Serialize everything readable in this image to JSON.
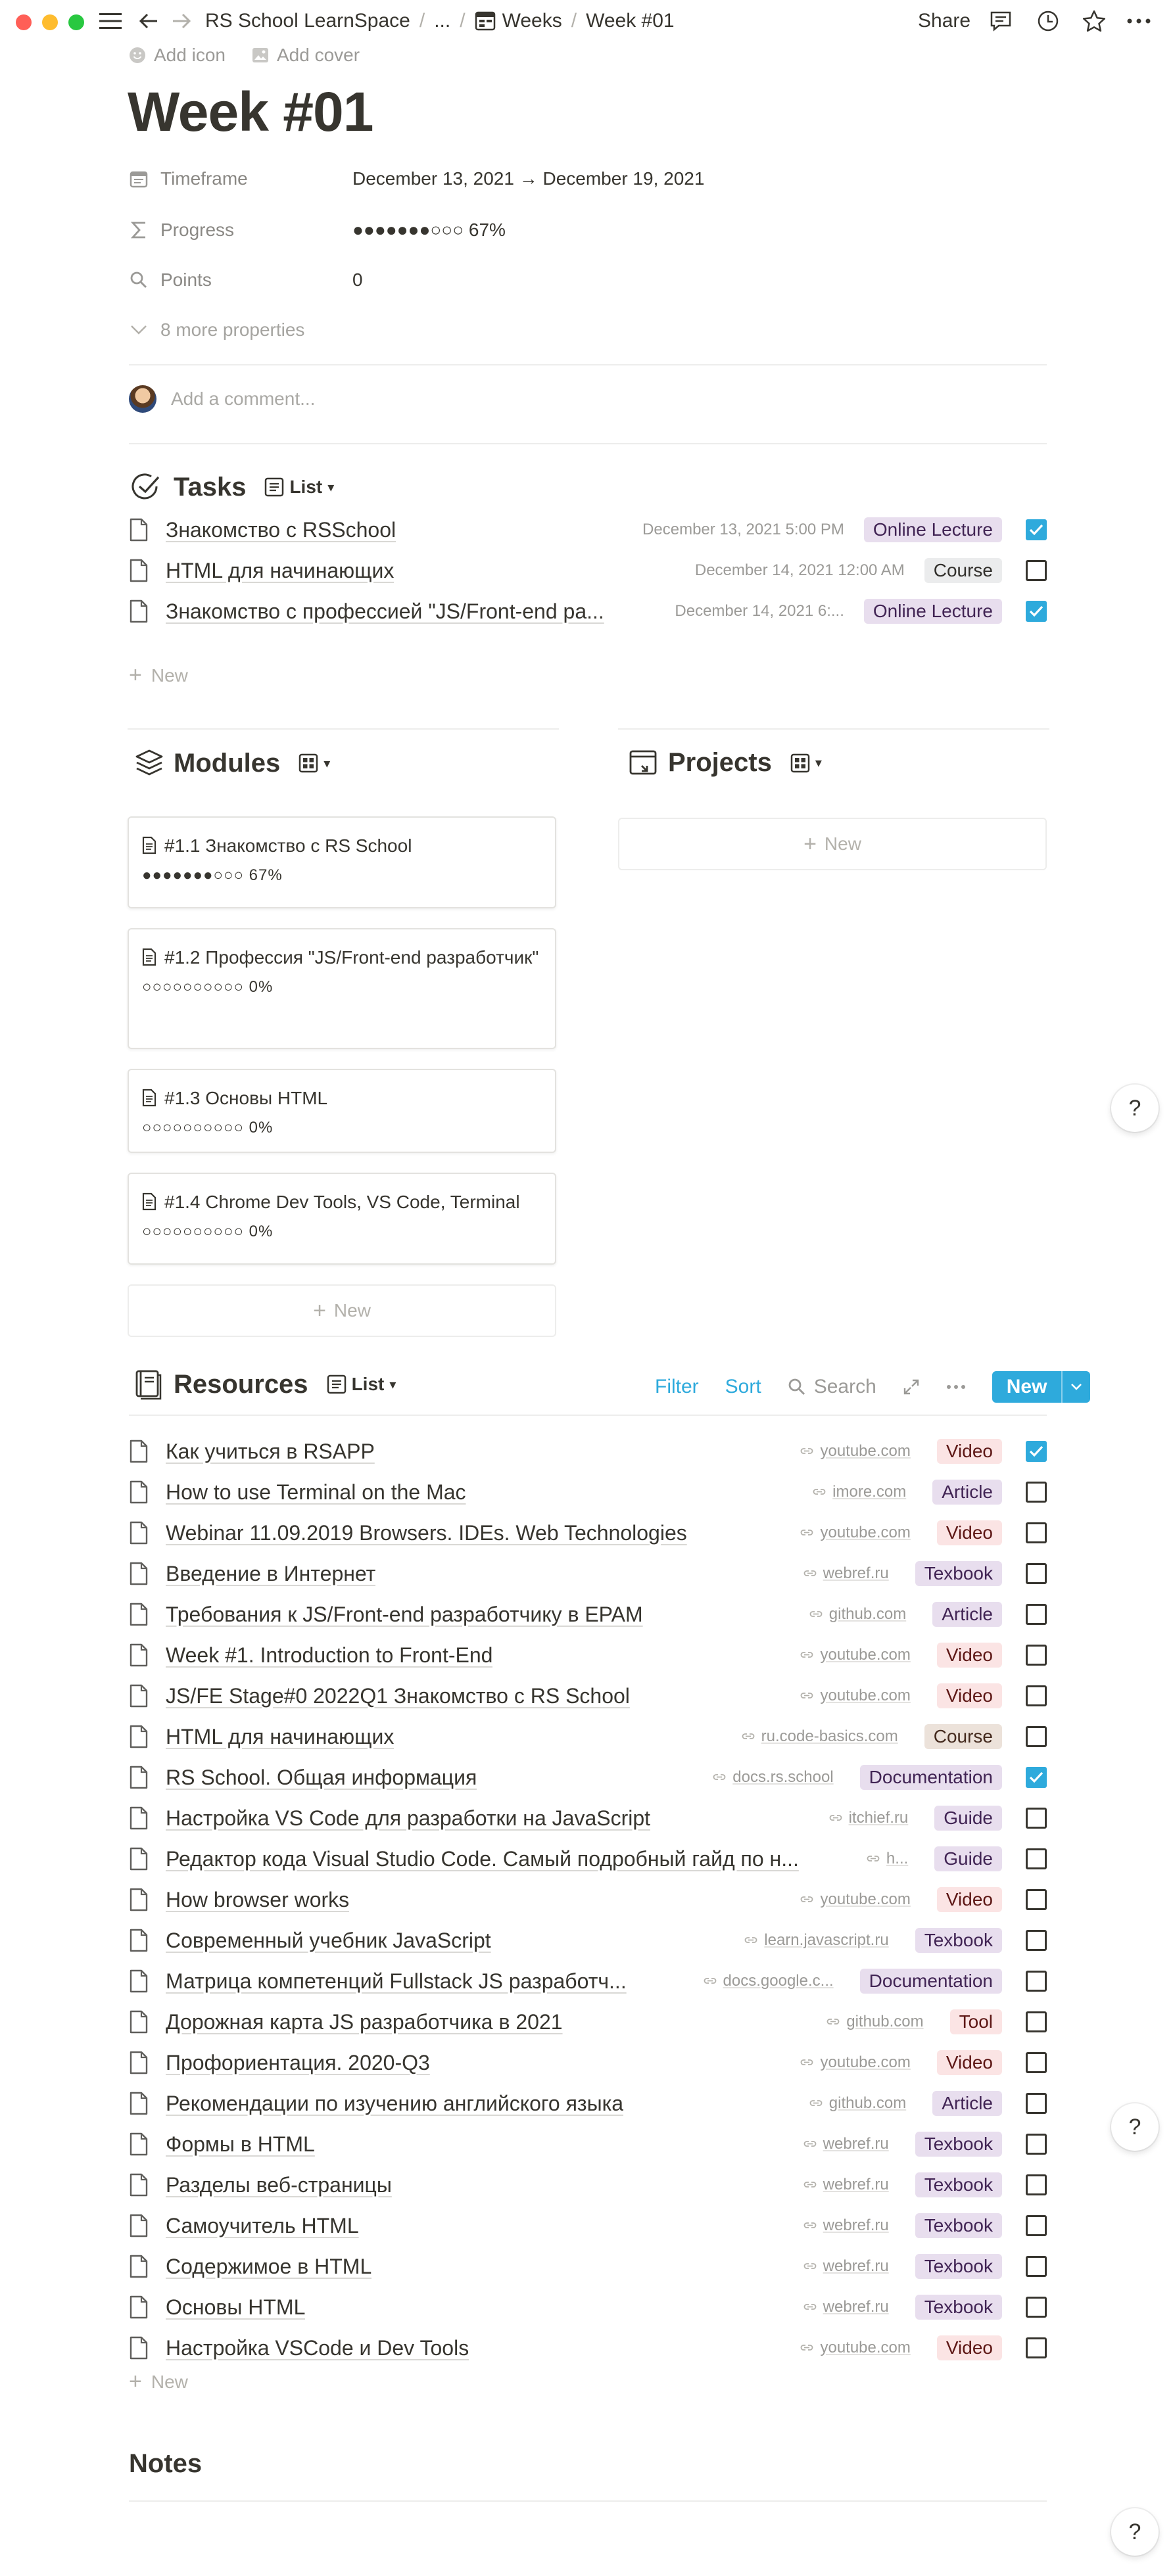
{
  "breadcrumb": [
    "RS School LearnSpace",
    "...",
    "Weeks",
    "Week #01"
  ],
  "topbar": {
    "share_label": "Share"
  },
  "page": {
    "add_icon_label": "Add icon",
    "add_cover_label": "Add cover",
    "title": "Week #01",
    "properties": [
      {
        "label": "Timeframe",
        "value": "December 13, 2021 → December 19, 2021",
        "icon": "calendar-icon"
      },
      {
        "label": "Progress",
        "value": "●●●●●●●○○○ 67%",
        "icon": "sigma-icon"
      },
      {
        "label": "Points",
        "value": "0",
        "icon": "search-icon"
      }
    ],
    "more_properties_label": "8 more properties",
    "comment_placeholder": "Add a comment..."
  },
  "tasks": {
    "title": "Tasks",
    "view_label": "List",
    "items": [
      {
        "title": "Знакомство с RSSchool",
        "date": "December 13, 2021 5:00 PM",
        "tag": "Online Lecture",
        "tag_color": "purple",
        "checked": true
      },
      {
        "title": "HTML для начинающих",
        "date": "December 14, 2021 12:00 AM",
        "tag": "Course",
        "tag_color": "gray",
        "checked": false
      },
      {
        "title": "Знакомство с профессией \"JS/Front-end ра...",
        "date": "December 14, 2021 6:...",
        "tag": "Online Lecture",
        "tag_color": "purple",
        "checked": true
      }
    ],
    "new_label": "New"
  },
  "modules": {
    "title": "Modules",
    "cards": [
      {
        "title": "#1.1 Знакомство с RS School",
        "progress": "●●●●●●●○○○ 67%"
      },
      {
        "title": "#1.2 Профессия \"JS/Front-end разработчик\"",
        "progress": "○○○○○○○○○○ 0%"
      },
      {
        "title": "#1.3 Основы HTML",
        "progress": "○○○○○○○○○○ 0%"
      },
      {
        "title": "#1.4 Chrome Dev Tools, VS Code, Terminal",
        "progress": "○○○○○○○○○○ 0%"
      }
    ],
    "new_label": "New"
  },
  "projects": {
    "title": "Projects",
    "new_label": "New"
  },
  "resources": {
    "title": "Resources",
    "view_label": "List",
    "toolbar": {
      "filter": "Filter",
      "sort": "Sort",
      "search": "Search",
      "new": "New"
    },
    "items": [
      {
        "title": "Как учиться в RSAPP",
        "domain": "youtube.com",
        "tag": "Video",
        "tag_color": "red",
        "checked": true
      },
      {
        "title": "How to use Terminal on the Mac",
        "domain": "imore.com",
        "tag": "Article",
        "tag_color": "purple",
        "checked": false
      },
      {
        "title": "Webinar 11.09.2019 Browsers. IDEs. Web Technologies",
        "domain": "youtube.com",
        "tag": "Video",
        "tag_color": "red",
        "checked": false
      },
      {
        "title": "Введение в Интернет",
        "domain": "webref.ru",
        "tag": "Texbook",
        "tag_color": "purple",
        "checked": false
      },
      {
        "title": "Требования к JS/Front-end разработчику в EPAM",
        "domain": "github.com",
        "tag": "Article",
        "tag_color": "purple",
        "checked": false
      },
      {
        "title": "Week #1. Introduction to Front-End",
        "domain": "youtube.com",
        "tag": "Video",
        "tag_color": "red",
        "checked": false
      },
      {
        "title": "JS/FE Stage#0 2022Q1 Знакомство с RS School",
        "domain": "youtube.com",
        "tag": "Video",
        "tag_color": "red",
        "checked": false
      },
      {
        "title": "HTML для начинающих",
        "domain": "ru.code-basics.com",
        "tag": "Course",
        "tag_color": "brown",
        "checked": false
      },
      {
        "title": "RS School. Общая информация",
        "domain": "docs.rs.school",
        "tag": "Documentation",
        "tag_color": "purple",
        "checked": true
      },
      {
        "title": "Настройка VS Code для разработки на JavaScript",
        "domain": "itchief.ru",
        "tag": "Guide",
        "tag_color": "purple",
        "checked": false
      },
      {
        "title": "Редактор кода Visual Studio Code. Самый подробный гайд по н...",
        "domain": "h...",
        "tag": "Guide",
        "tag_color": "purple",
        "checked": false
      },
      {
        "title": "How browser works",
        "domain": "youtube.com",
        "tag": "Video",
        "tag_color": "red",
        "checked": false
      },
      {
        "title": "Современный учебник JavaScript",
        "domain": "learn.javascript.ru",
        "tag": "Texbook",
        "tag_color": "purple",
        "checked": false
      },
      {
        "title": "Матрица компетенций Fullstack JS разработч...",
        "domain": "docs.google.c...",
        "tag": "Documentation",
        "tag_color": "purple",
        "checked": false
      },
      {
        "title": "Дорожная карта JS разработчика в 2021",
        "domain": "github.com",
        "tag": "Tool",
        "tag_color": "red",
        "checked": false
      },
      {
        "title": "Профориентация. 2020-Q3",
        "domain": "youtube.com",
        "tag": "Video",
        "tag_color": "red",
        "checked": false
      },
      {
        "title": "Рекомендации по изучению английского языка",
        "domain": "github.com",
        "tag": "Article",
        "tag_color": "purple",
        "checked": false
      },
      {
        "title": "Формы в HTML",
        "domain": "webref.ru",
        "tag": "Texbook",
        "tag_color": "purple",
        "checked": false
      },
      {
        "title": "Разделы веб-страницы",
        "domain": "webref.ru",
        "tag": "Texbook",
        "tag_color": "purple",
        "checked": false
      },
      {
        "title": "Самоучитель HTML",
        "domain": "webref.ru",
        "tag": "Texbook",
        "tag_color": "purple",
        "checked": false
      },
      {
        "title": "Содержимое в HTML",
        "domain": "webref.ru",
        "tag": "Texbook",
        "tag_color": "purple",
        "checked": false
      },
      {
        "title": "Основы HTML",
        "domain": "webref.ru",
        "tag": "Texbook",
        "tag_color": "purple",
        "checked": false
      },
      {
        "title": "Настройка VSCode и Dev Tools",
        "domain": "youtube.com",
        "tag": "Video",
        "tag_color": "red",
        "checked": false
      }
    ],
    "new_label": "New"
  },
  "notes": {
    "title": "Notes"
  },
  "help": {
    "label": "?"
  },
  "colors": {
    "accent": "#2eaadc",
    "text": "#37352f",
    "muted": "#9b9a97"
  }
}
